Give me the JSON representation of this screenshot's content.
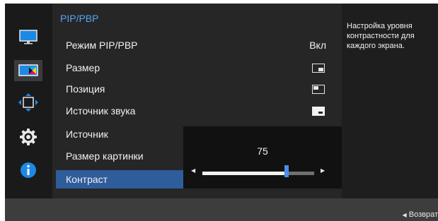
{
  "menu": {
    "title": "PIP/PBP",
    "items": [
      {
        "label": "Режим PIP/PBP",
        "value": "Вкл"
      },
      {
        "label": "Размер",
        "icon": "size-pip-icon"
      },
      {
        "label": "Позиция",
        "icon": "position-top-left-icon"
      },
      {
        "label": "Источник звука",
        "icon": "sound-source-icon"
      },
      {
        "label": "Источник"
      },
      {
        "label": "Размер картинки"
      },
      {
        "label": "Контраст"
      }
    ]
  },
  "slider": {
    "value": "75",
    "level": 75,
    "max": 100
  },
  "description": "Настройка уровня контрастности для каждого экрана.",
  "footer": {
    "back_label": "Возврат"
  },
  "sidebar_icons": [
    "monitor-picture-icon",
    "color-icon",
    "onscreen-display-icon",
    "system-gear-icon",
    "information-icon"
  ],
  "colors": {
    "accent": "#53a6f2",
    "selected": "#2f5d9b",
    "slider_thumb": "#4a8ee6"
  }
}
